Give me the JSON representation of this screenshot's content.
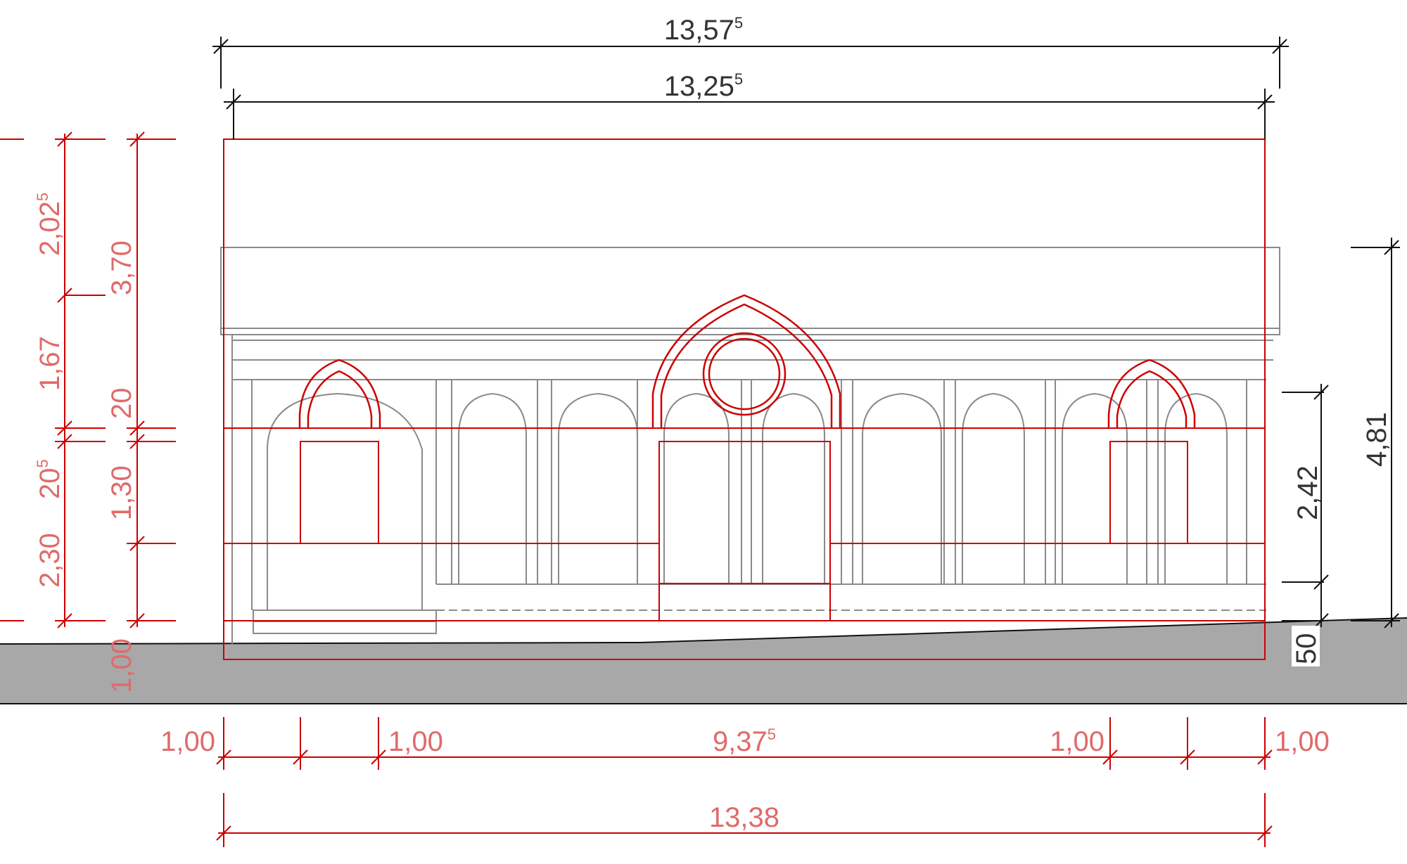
{
  "dimensions": {
    "top_outer": {
      "main": "13,57",
      "sup": "5"
    },
    "top_inner": {
      "main": "13,25",
      "sup": "5"
    },
    "left_a": {
      "main": "2,02",
      "sup": "5"
    },
    "left_b": "1,67",
    "left_c": {
      "main": "20",
      "sup": "5"
    },
    "left_d": "2,30",
    "left_total": "3,70",
    "left_e": "20",
    "left_f": "1,30",
    "left_g": "1,00",
    "right_a": "2,42",
    "right_total": "4,81",
    "right_b": "50",
    "bottom_1": "1,00",
    "bottom_2": "1,00",
    "bottom_mid": {
      "main": "9,37",
      "sup": "5"
    },
    "bottom_3": "1,00",
    "bottom_4": "1,00",
    "bottom_total": "13,38"
  },
  "colors": {
    "red_lines": "#cc0000",
    "red_text": "#e06a6a",
    "black_lines": "#111111",
    "grey_lines": "#8a8a8a",
    "ground": "#a8a8a8"
  }
}
